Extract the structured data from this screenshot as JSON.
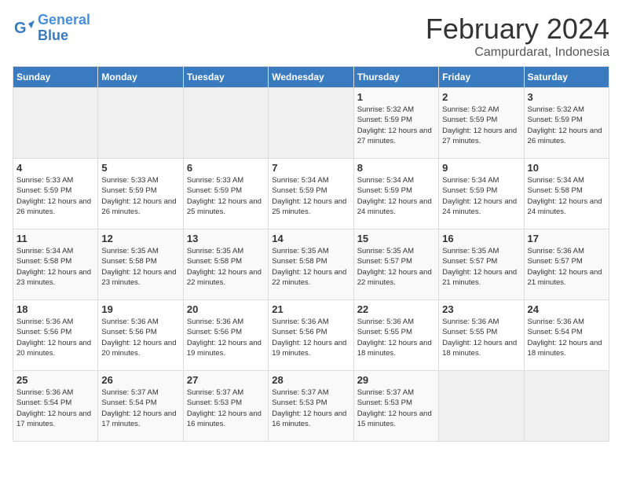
{
  "logo": {
    "text_general": "General",
    "text_blue": "Blue"
  },
  "header": {
    "month": "February 2024",
    "location": "Campurdarat, Indonesia"
  },
  "weekdays": [
    "Sunday",
    "Monday",
    "Tuesday",
    "Wednesday",
    "Thursday",
    "Friday",
    "Saturday"
  ],
  "weeks": [
    [
      {
        "day": "",
        "sunrise": "",
        "sunset": "",
        "daylight": ""
      },
      {
        "day": "",
        "sunrise": "",
        "sunset": "",
        "daylight": ""
      },
      {
        "day": "",
        "sunrise": "",
        "sunset": "",
        "daylight": ""
      },
      {
        "day": "",
        "sunrise": "",
        "sunset": "",
        "daylight": ""
      },
      {
        "day": "1",
        "sunrise": "5:32 AM",
        "sunset": "5:59 PM",
        "daylight": "12 hours and 27 minutes."
      },
      {
        "day": "2",
        "sunrise": "5:32 AM",
        "sunset": "5:59 PM",
        "daylight": "12 hours and 27 minutes."
      },
      {
        "day": "3",
        "sunrise": "5:32 AM",
        "sunset": "5:59 PM",
        "daylight": "12 hours and 26 minutes."
      }
    ],
    [
      {
        "day": "4",
        "sunrise": "5:33 AM",
        "sunset": "5:59 PM",
        "daylight": "12 hours and 26 minutes."
      },
      {
        "day": "5",
        "sunrise": "5:33 AM",
        "sunset": "5:59 PM",
        "daylight": "12 hours and 26 minutes."
      },
      {
        "day": "6",
        "sunrise": "5:33 AM",
        "sunset": "5:59 PM",
        "daylight": "12 hours and 25 minutes."
      },
      {
        "day": "7",
        "sunrise": "5:34 AM",
        "sunset": "5:59 PM",
        "daylight": "12 hours and 25 minutes."
      },
      {
        "day": "8",
        "sunrise": "5:34 AM",
        "sunset": "5:59 PM",
        "daylight": "12 hours and 24 minutes."
      },
      {
        "day": "9",
        "sunrise": "5:34 AM",
        "sunset": "5:59 PM",
        "daylight": "12 hours and 24 minutes."
      },
      {
        "day": "10",
        "sunrise": "5:34 AM",
        "sunset": "5:58 PM",
        "daylight": "12 hours and 24 minutes."
      }
    ],
    [
      {
        "day": "11",
        "sunrise": "5:34 AM",
        "sunset": "5:58 PM",
        "daylight": "12 hours and 23 minutes."
      },
      {
        "day": "12",
        "sunrise": "5:35 AM",
        "sunset": "5:58 PM",
        "daylight": "12 hours and 23 minutes."
      },
      {
        "day": "13",
        "sunrise": "5:35 AM",
        "sunset": "5:58 PM",
        "daylight": "12 hours and 22 minutes."
      },
      {
        "day": "14",
        "sunrise": "5:35 AM",
        "sunset": "5:58 PM",
        "daylight": "12 hours and 22 minutes."
      },
      {
        "day": "15",
        "sunrise": "5:35 AM",
        "sunset": "5:57 PM",
        "daylight": "12 hours and 22 minutes."
      },
      {
        "day": "16",
        "sunrise": "5:35 AM",
        "sunset": "5:57 PM",
        "daylight": "12 hours and 21 minutes."
      },
      {
        "day": "17",
        "sunrise": "5:36 AM",
        "sunset": "5:57 PM",
        "daylight": "12 hours and 21 minutes."
      }
    ],
    [
      {
        "day": "18",
        "sunrise": "5:36 AM",
        "sunset": "5:56 PM",
        "daylight": "12 hours and 20 minutes."
      },
      {
        "day": "19",
        "sunrise": "5:36 AM",
        "sunset": "5:56 PM",
        "daylight": "12 hours and 20 minutes."
      },
      {
        "day": "20",
        "sunrise": "5:36 AM",
        "sunset": "5:56 PM",
        "daylight": "12 hours and 19 minutes."
      },
      {
        "day": "21",
        "sunrise": "5:36 AM",
        "sunset": "5:56 PM",
        "daylight": "12 hours and 19 minutes."
      },
      {
        "day": "22",
        "sunrise": "5:36 AM",
        "sunset": "5:55 PM",
        "daylight": "12 hours and 18 minutes."
      },
      {
        "day": "23",
        "sunrise": "5:36 AM",
        "sunset": "5:55 PM",
        "daylight": "12 hours and 18 minutes."
      },
      {
        "day": "24",
        "sunrise": "5:36 AM",
        "sunset": "5:54 PM",
        "daylight": "12 hours and 18 minutes."
      }
    ],
    [
      {
        "day": "25",
        "sunrise": "5:36 AM",
        "sunset": "5:54 PM",
        "daylight": "12 hours and 17 minutes."
      },
      {
        "day": "26",
        "sunrise": "5:37 AM",
        "sunset": "5:54 PM",
        "daylight": "12 hours and 17 minutes."
      },
      {
        "day": "27",
        "sunrise": "5:37 AM",
        "sunset": "5:53 PM",
        "daylight": "12 hours and 16 minutes."
      },
      {
        "day": "28",
        "sunrise": "5:37 AM",
        "sunset": "5:53 PM",
        "daylight": "12 hours and 16 minutes."
      },
      {
        "day": "29",
        "sunrise": "5:37 AM",
        "sunset": "5:53 PM",
        "daylight": "12 hours and 15 minutes."
      },
      {
        "day": "",
        "sunrise": "",
        "sunset": "",
        "daylight": ""
      },
      {
        "day": "",
        "sunrise": "",
        "sunset": "",
        "daylight": ""
      }
    ]
  ]
}
